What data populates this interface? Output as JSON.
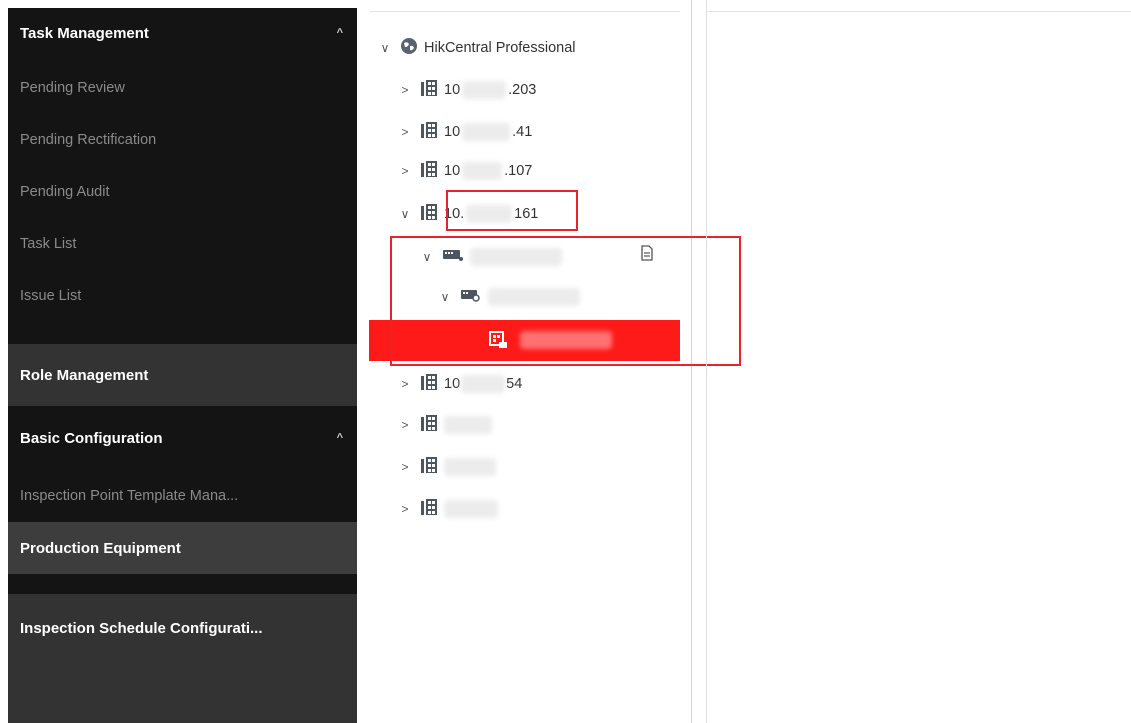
{
  "sidebar": {
    "task_management": {
      "title": "Task Management",
      "items": [
        "Pending Review",
        "Pending Rectification",
        "Pending Audit",
        "Task List",
        "Issue List"
      ]
    },
    "role_management": "Role Management",
    "basic_configuration": {
      "title": "Basic Configuration",
      "items": [
        "Inspection Point Template Mana...",
        "Production Equipment"
      ]
    },
    "inspection_schedule": "Inspection Schedule Configurati..."
  },
  "tree": {
    "root": "HikCentral Professional",
    "sites": [
      {
        "prefix": "10",
        "suffix": ".203"
      },
      {
        "prefix": "10",
        "suffix": ".41"
      },
      {
        "prefix": "10",
        "suffix": ".107"
      },
      {
        "prefix": "10.",
        "suffix": "161"
      },
      {
        "prefix": "10",
        "suffix": "54"
      }
    ]
  },
  "colors": {
    "sidebar_bg": "#141414",
    "highlight_red": "#ff1a1a",
    "annotation_red": "#e8232a"
  },
  "icons": [
    "chevron-up-icon",
    "chevron-down-icon",
    "chevron-right-icon",
    "globe-icon",
    "building-icon",
    "nvr-icon",
    "camera-channel-icon",
    "device-icon",
    "document-icon"
  ]
}
